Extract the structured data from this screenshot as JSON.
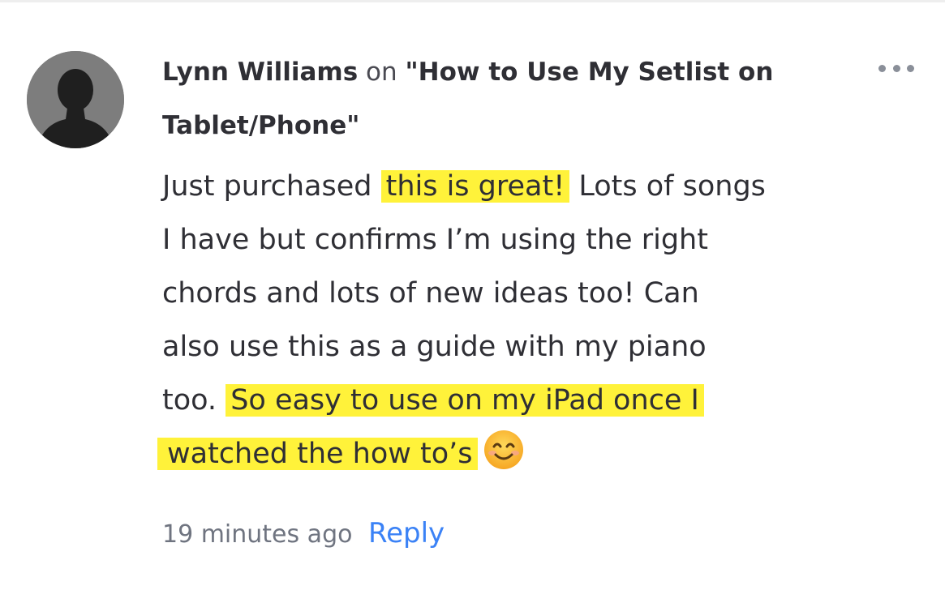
{
  "comment": {
    "author": "Lynn Williams",
    "on_word": "on",
    "post_title": "\"How to Use My Setlist on Tablet/Phone\"",
    "body": {
      "line1_text": "Just purchased ",
      "line1_highlight": "this is great!",
      "line1_rest": " Lots of songs",
      "line2": "I have but confirms I’m using the right",
      "line3": "chords and lots of new ideas too! Can",
      "line4": "also use this as a guide with my piano",
      "line5_text": "too. ",
      "line5_highlight": "So easy to use on my iPad once I",
      "line6_highlight": "watched the how to’s",
      "emoji": "smiling-face-emoji"
    },
    "timestamp": "19 minutes ago",
    "reply_label": "Reply",
    "more_icon": "ellipsis-icon"
  },
  "colors": {
    "highlight": "#fff23a",
    "link": "#3b82f6",
    "text": "#2f2f35",
    "muted": "#6f7480",
    "avatar_bg": "#7d7d7d"
  }
}
